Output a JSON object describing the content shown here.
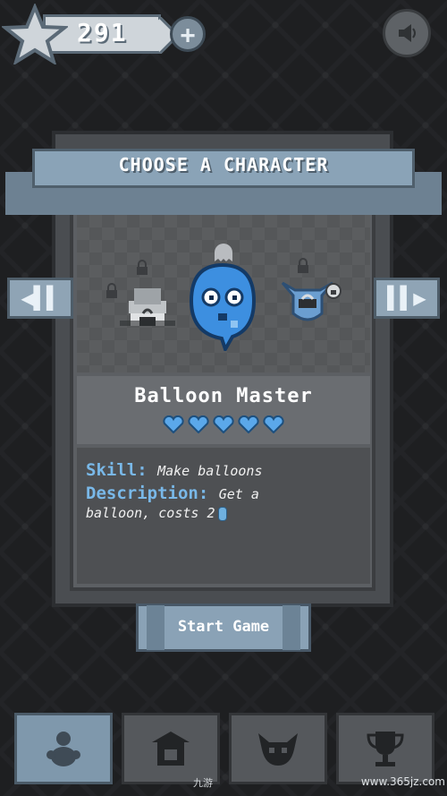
{
  "top_bar": {
    "score": "291",
    "plus_icon": "plus-icon",
    "sound_icon": "sound-icon"
  },
  "panel": {
    "title": "CHOOSE A CHARACTER",
    "character_name": "Balloon Master",
    "hearts": 5,
    "skill_label": "Skill:",
    "skill_value": "Make balloons",
    "description_label": "Description:",
    "description_part1": "Get a",
    "description_part2": "balloon, costs 2"
  },
  "start_button": {
    "label": "Start Game"
  },
  "bottom_nav": [
    {
      "name": "characters",
      "icon": "characters-icon"
    },
    {
      "name": "shop",
      "icon": "shop-icon"
    },
    {
      "name": "monsters",
      "icon": "monster-icon"
    },
    {
      "name": "trophies",
      "icon": "trophy-icon"
    }
  ],
  "watermarks": {
    "left": "九游",
    "right": "www.365jz.com"
  },
  "colors": {
    "accent_blue": "#79b8e8",
    "banner_blue": "#8aa3b7",
    "panel_gray": "#5c5f63"
  }
}
